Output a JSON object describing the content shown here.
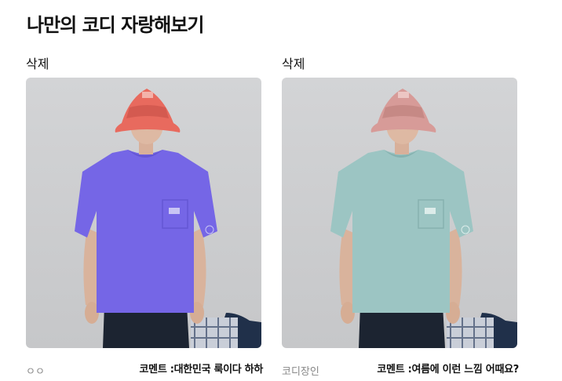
{
  "page": {
    "title": "나만의 코디 자랑해보기"
  },
  "cards": [
    {
      "delete_label": "삭제",
      "author": "ㅇㅇ",
      "comment": "코멘트 :대한민국 룩이다 하하",
      "colors": {
        "hat": "#e86a5e",
        "hat_band": "#d45a50",
        "shirt": "#7566e6",
        "shirt_shade": "#6456d4"
      }
    },
    {
      "delete_label": "삭제",
      "author": "코디장인",
      "comment": "코멘트 :여름에 이런 느낌 어때요?",
      "colors": {
        "hat": "#d79b98",
        "hat_band": "#c68985",
        "shirt": "#9cc5c3",
        "shirt_shade": "#86b2b0"
      }
    }
  ]
}
